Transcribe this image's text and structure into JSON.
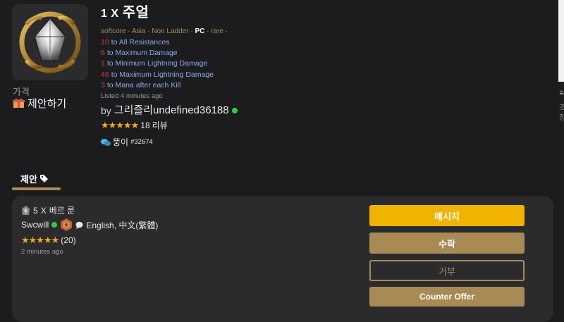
{
  "item": {
    "qty": "1",
    "x": "X",
    "name": "주얼",
    "meta": {
      "mode": "softcore",
      "region": "Asia",
      "ladder": "Non Ladder",
      "platform": "PC",
      "rarity": "rare",
      "sep": "·"
    },
    "mods": [
      {
        "value": "10",
        "text": "to All Resistances"
      },
      {
        "value": "6",
        "text": "to Maximum Damage"
      },
      {
        "value": "1",
        "text": "to Minimum Lightning Damage"
      },
      {
        "value": "46",
        "text": "to Maximum Lightning Damage"
      },
      {
        "value": "3",
        "text": "to Mana after each Kill"
      }
    ],
    "listed": "Listed 4 minutes ago",
    "icon": "jewel-icon"
  },
  "price": {
    "label": "가격",
    "make_offer": "제안하기",
    "icon": "gift-icon"
  },
  "seller": {
    "by": "by",
    "name": "그리즐리undefined36188",
    "status_color": "#2ecc40",
    "stars": "★★★★★",
    "review_count": "18",
    "review_label": "리뷰",
    "guild_name": "뚱이",
    "guild_tag": "#32674"
  },
  "tabs": {
    "offers_label": "제안",
    "icon": "tag-icon"
  },
  "offer": {
    "qty": "5",
    "x": "X",
    "item": "베르 룬",
    "user": "Swcwill",
    "languages": "English, 中文(繁體)",
    "stars": "★★★★★",
    "review_count": "(20)",
    "time": "2 minutes ago",
    "buttons": {
      "message": "메시지",
      "accept": "수락",
      "decline": "거부",
      "counter": "Counter Offer"
    }
  },
  "edge": {
    "chars": [
      "ല",
      "조",
      "정"
    ]
  },
  "colors": {
    "accent_gold": "#a78a54",
    "message_yellow": "#f0b400",
    "mod_blue": "#8aa8f0",
    "mod_red": "#d43a3a",
    "background": "#1c1c1e",
    "card": "#2b2b2e"
  }
}
